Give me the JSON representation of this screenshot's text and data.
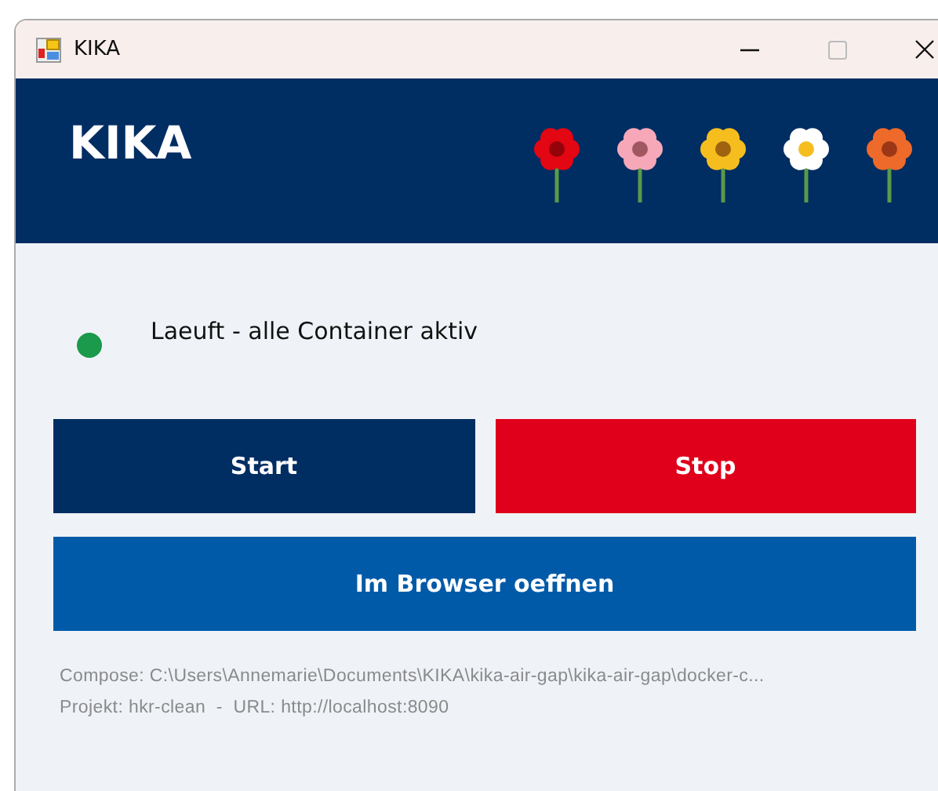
{
  "window": {
    "title": "KIKA"
  },
  "header": {
    "title": "KIKA",
    "flowers": [
      {
        "color": "#e30613"
      },
      {
        "color": "#f7a8b8"
      },
      {
        "color": "#f5be1e"
      },
      {
        "color": "#ffffff"
      },
      {
        "color": "#ee6a2a"
      }
    ]
  },
  "status": {
    "text": "Laeuft - alle Container aktiv",
    "color": "#1a9a4a"
  },
  "buttons": [
    {
      "label": "Start",
      "kind": "dark"
    },
    {
      "label": "Stop",
      "kind": "red"
    },
    {
      "label": "Im Browser oeffnen",
      "kind": "blue"
    }
  ],
  "info": [
    "Compose: C:\\Users\\Annemarie\\Documents\\KIKA\\kika-air-gap\\kika-air-gap\\docker-c...",
    "Projekt: hkr-clean  -  URL: http://localhost:8090"
  ]
}
